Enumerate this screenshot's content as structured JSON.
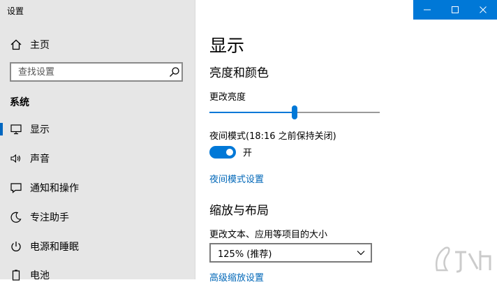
{
  "window": {
    "title": "设置"
  },
  "sidebar": {
    "home_label": "主页",
    "search_placeholder": "查找设置",
    "section": "系统",
    "items": [
      {
        "label": "显示",
        "icon": "monitor-icon",
        "active": true
      },
      {
        "label": "声音",
        "icon": "speaker-icon"
      },
      {
        "label": "通知和操作",
        "icon": "notification-icon"
      },
      {
        "label": "专注助手",
        "icon": "moon-icon"
      },
      {
        "label": "电源和睡眠",
        "icon": "power-icon"
      },
      {
        "label": "电池",
        "icon": "battery-icon"
      }
    ]
  },
  "main": {
    "title": "显示",
    "brightness_section": "亮度和颜色",
    "brightness_label": "更改亮度",
    "brightness_value": 0.5,
    "night_mode_label": "夜间模式(18:16 之前保持关闭)",
    "night_mode_state": "开",
    "night_mode_link": "夜间模式设置",
    "scale_section": "缩放与布局",
    "scale_label": "更改文本、应用等项目的大小",
    "scale_value": "125% (推荐)",
    "advanced_scale_link": "高级缩放设置"
  },
  "colors": {
    "accent": "#0078d7",
    "link": "#0067b8",
    "sidebar_bg": "#e6e6e6"
  }
}
